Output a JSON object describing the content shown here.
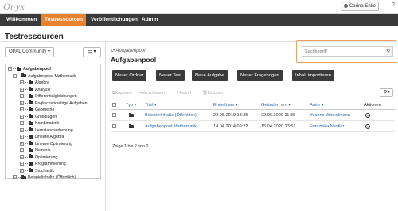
{
  "app": {
    "logo": "Onyx",
    "user": "Carina Enke"
  },
  "nav": {
    "items": [
      {
        "label": "Willkommen",
        "active": false
      },
      {
        "label": "Testressourcen",
        "active": true
      },
      {
        "label": "Veröffentlichungen",
        "active": false
      },
      {
        "label": "Admin",
        "active": false
      }
    ]
  },
  "page": {
    "title": "Testressourcen"
  },
  "left": {
    "community_label": "OPAL Community",
    "tree": [
      {
        "label": "Aufgabenpool",
        "level": 0,
        "selected": true,
        "toggle": "−"
      },
      {
        "label": "Aufgabenpool Mathematik",
        "level": 1,
        "toggle": "−"
      },
      {
        "label": "Algebra",
        "level": 2,
        "toggle": "+"
      },
      {
        "label": "Analysis",
        "level": 2,
        "toggle": "+"
      },
      {
        "label": "Differentialgleichungen",
        "level": 2,
        "toggle": "+"
      },
      {
        "label": "Englischsprachige Aufgaben",
        "level": 2,
        "toggle": "+"
      },
      {
        "label": "Geometrie",
        "level": 2,
        "toggle": "+"
      },
      {
        "label": "Grundlagen",
        "level": 2,
        "toggle": "+"
      },
      {
        "label": "Kombinatorik",
        "level": 2,
        "toggle": "+"
      },
      {
        "label": "Lernstandserhebung",
        "level": 2,
        "toggle": "+"
      },
      {
        "label": "Lineare Algebra",
        "level": 2,
        "toggle": "+"
      },
      {
        "label": "Lineare Optimierung",
        "level": 2,
        "toggle": "+"
      },
      {
        "label": "Numerik",
        "level": 2,
        "toggle": "+"
      },
      {
        "label": "Optimierung",
        "level": 2,
        "toggle": "+"
      },
      {
        "label": "Programmierung",
        "level": 2,
        "toggle": "+"
      },
      {
        "label": "Stochastik",
        "level": 2,
        "toggle": "+"
      },
      {
        "label": "Beispielinhalte (Öffentlich)",
        "level": 1,
        "toggle": "+"
      }
    ]
  },
  "main": {
    "breadcrumb": "Aufgabenpool",
    "title": "Aufgabenpool",
    "search_placeholder": "Suchbegriff",
    "actions": [
      "Neuer Ordner",
      "Neuer Test",
      "Neue Aufgabe",
      "Neuer Fragebogen",
      "Inhalt importieren"
    ],
    "tools": [
      "Kopieren",
      "Verschieben",
      "Export",
      "Löschen"
    ],
    "columns": {
      "typ": "Typ",
      "titel": "Titel",
      "erstellt": "Erstellt am",
      "geaendert": "Geändert am",
      "autor": "Autor",
      "aktionen": "Aktionen"
    },
    "rows": [
      {
        "title": "Beispielinhalte (Öffentlich)",
        "created": "23.05.2019 13:35",
        "modified": "22.06.2020 11:36",
        "author": "Yvonne Winkelmann"
      },
      {
        "title": "Aufgabenpool Mathematik",
        "created": "14.04.2014 09:22",
        "modified": "15.04.2020 13:51",
        "author": "Franziska Nestler"
      }
    ],
    "pager": "Zeige 1 bis 2 von 2"
  },
  "colors": {
    "accent": "#e9822d",
    "nav_bg": "#3a3a3a",
    "link": "#3366aa"
  }
}
